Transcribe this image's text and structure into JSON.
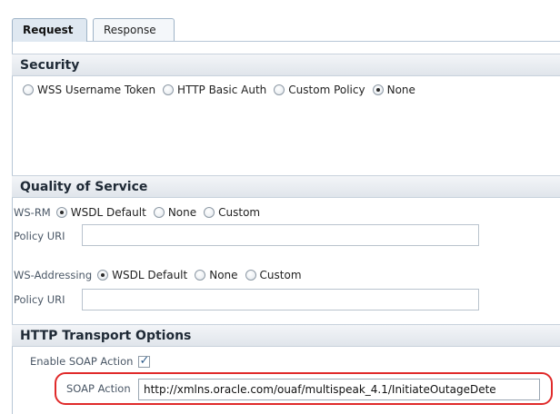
{
  "tabs": [
    {
      "label": "Request",
      "active": true
    },
    {
      "label": "Response",
      "active": false
    }
  ],
  "security": {
    "title": "Security",
    "options": [
      {
        "label": "WSS Username Token",
        "selected": false
      },
      {
        "label": "HTTP Basic Auth",
        "selected": false
      },
      {
        "label": "Custom Policy",
        "selected": false
      },
      {
        "label": "None",
        "selected": true
      }
    ]
  },
  "qos": {
    "title": "Quality of Service",
    "wsrm": {
      "label": "WS-RM",
      "options": [
        {
          "label": "WSDL Default",
          "selected": true
        },
        {
          "label": "None",
          "selected": false
        },
        {
          "label": "Custom",
          "selected": false
        }
      ],
      "policy_label": "Policy URI",
      "policy_value": ""
    },
    "wsaddressing": {
      "label": "WS-Addressing",
      "options": [
        {
          "label": "WSDL Default",
          "selected": true
        },
        {
          "label": "None",
          "selected": false
        },
        {
          "label": "Custom",
          "selected": false
        }
      ],
      "policy_label": "Policy URI",
      "policy_value": ""
    }
  },
  "http": {
    "title": "HTTP Transport Options",
    "enable_soap_label": "Enable SOAP Action",
    "enable_soap_checked": true,
    "soap_action_label": "SOAP Action",
    "soap_action_value": "http://xmlns.oracle.com/ouaf/multispeak_4.1/InitiateOutageDete"
  },
  "colors": {
    "highlight": "#e02a2a",
    "section_header": "#e0e5eb",
    "checkmark": "#2f5d8c"
  }
}
